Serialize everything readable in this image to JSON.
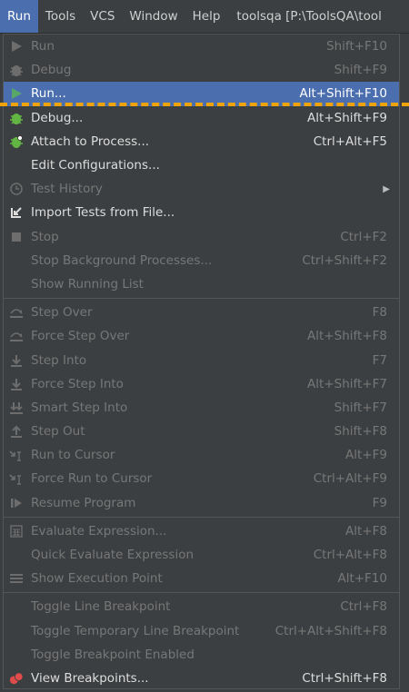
{
  "menubar": {
    "items": [
      "Run",
      "Tools",
      "VCS",
      "Window",
      "Help"
    ],
    "title": "toolsqa [P:\\ToolsQA\\tool"
  },
  "menu": {
    "groups": [
      [
        {
          "label": "Run",
          "shortcut": "Shift+F10",
          "icon": "play-icon",
          "state": "disabled"
        },
        {
          "label": "Debug",
          "shortcut": "Shift+F9",
          "icon": "bug-icon",
          "state": "disabled"
        },
        {
          "label": "Run...",
          "shortcut": "Alt+Shift+F10",
          "icon": "play-icon",
          "state": "selected"
        },
        {
          "label": "Debug...",
          "shortcut": "Alt+Shift+F9",
          "icon": "bug-icon",
          "state": "enabled"
        },
        {
          "label": "Attach to Process...",
          "shortcut": "Ctrl+Alt+F5",
          "icon": "attach-bug-icon",
          "state": "enabled"
        },
        {
          "label": "Edit Configurations...",
          "shortcut": "",
          "icon": "",
          "state": "enabled"
        },
        {
          "label": "Test History",
          "shortcut": "",
          "icon": "clock-icon",
          "state": "disabled",
          "submenu": true
        },
        {
          "label": "Import Tests from File...",
          "shortcut": "",
          "icon": "import-icon",
          "state": "enabled"
        },
        {
          "label": "Stop",
          "shortcut": "Ctrl+F2",
          "icon": "stop-icon",
          "state": "disabled"
        },
        {
          "label": "Stop Background Processes...",
          "shortcut": "Ctrl+Shift+F2",
          "icon": "",
          "state": "disabled"
        },
        {
          "label": "Show Running List",
          "shortcut": "",
          "icon": "",
          "state": "disabled"
        }
      ],
      [
        {
          "label": "Step Over",
          "shortcut": "F8",
          "icon": "step-over-icon",
          "state": "disabled"
        },
        {
          "label": "Force Step Over",
          "shortcut": "Alt+Shift+F8",
          "icon": "force-step-over-icon",
          "state": "disabled"
        },
        {
          "label": "Step Into",
          "shortcut": "F7",
          "icon": "step-into-icon",
          "state": "disabled"
        },
        {
          "label": "Force Step Into",
          "shortcut": "Alt+Shift+F7",
          "icon": "force-step-into-icon",
          "state": "disabled"
        },
        {
          "label": "Smart Step Into",
          "shortcut": "Shift+F7",
          "icon": "smart-step-into-icon",
          "state": "disabled"
        },
        {
          "label": "Step Out",
          "shortcut": "Shift+F8",
          "icon": "step-out-icon",
          "state": "disabled"
        },
        {
          "label": "Run to Cursor",
          "shortcut": "Alt+F9",
          "icon": "run-to-cursor-icon",
          "state": "disabled"
        },
        {
          "label": "Force Run to Cursor",
          "shortcut": "Ctrl+Alt+F9",
          "icon": "force-run-to-cursor-icon",
          "state": "disabled"
        },
        {
          "label": "Resume Program",
          "shortcut": "F9",
          "icon": "resume-icon",
          "state": "disabled"
        }
      ],
      [
        {
          "label": "Evaluate Expression...",
          "shortcut": "Alt+F8",
          "icon": "calculator-icon",
          "state": "disabled"
        },
        {
          "label": "Quick Evaluate Expression",
          "shortcut": "Ctrl+Alt+F8",
          "icon": "",
          "state": "disabled"
        },
        {
          "label": "Show Execution Point",
          "shortcut": "Alt+F10",
          "icon": "execution-point-icon",
          "state": "disabled"
        }
      ],
      [
        {
          "label": "Toggle Line Breakpoint",
          "shortcut": "Ctrl+F8",
          "icon": "",
          "state": "disabled"
        },
        {
          "label": "Toggle Temporary Line Breakpoint",
          "shortcut": "Ctrl+Alt+Shift+F8",
          "icon": "",
          "state": "disabled"
        },
        {
          "label": "Toggle Breakpoint Enabled",
          "shortcut": "",
          "icon": "",
          "state": "disabled"
        },
        {
          "label": "View Breakpoints...",
          "shortcut": "Ctrl+Shift+F8",
          "icon": "breakpoints-icon",
          "state": "enabled"
        }
      ]
    ]
  },
  "colors": {
    "background": "#3c3f41",
    "selection": "#4b6eaf",
    "annotation": "#f0a30a",
    "play": "#59a869",
    "bug": "#62b543",
    "breakpoint": "#e04b4b"
  }
}
